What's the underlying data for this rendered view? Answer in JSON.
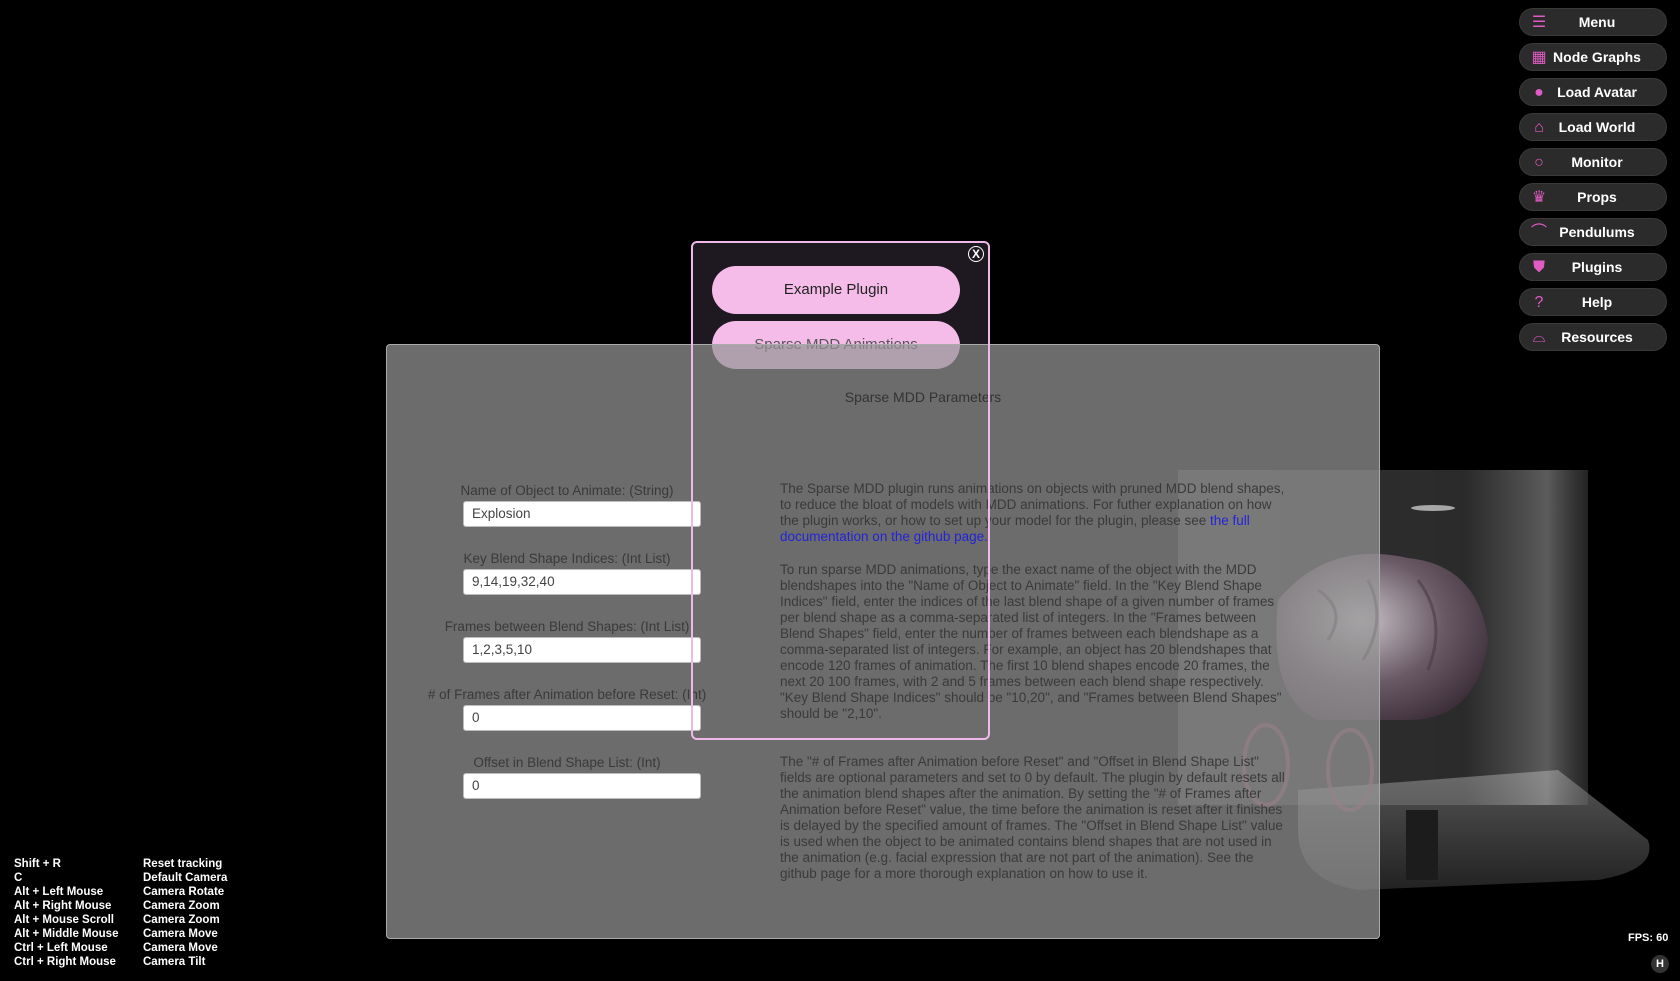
{
  "menu": [
    {
      "label": "Menu",
      "icon": "hamburger-icon"
    },
    {
      "label": "Node Graphs",
      "icon": "grid-icon"
    },
    {
      "label": "Load Avatar",
      "icon": "person-icon"
    },
    {
      "label": "Load World",
      "icon": "house-icon"
    },
    {
      "label": "Monitor",
      "icon": "magnifier-icon"
    },
    {
      "label": "Props",
      "icon": "crown-icon"
    },
    {
      "label": "Pendulums",
      "icon": "pendulum-icon"
    },
    {
      "label": "Plugins",
      "icon": "shield-icon"
    },
    {
      "label": "Help",
      "icon": "question-icon"
    },
    {
      "label": "Resources",
      "icon": "basket-icon"
    }
  ],
  "dialog": {
    "close_label": "X",
    "plugins": [
      "Example Plugin",
      "Sparse MDD Animations"
    ]
  },
  "panel": {
    "title": "Sparse MDD Parameters",
    "fields": [
      {
        "label": "Name of Object to Animate: (String)",
        "value": "Explosion"
      },
      {
        "label": "Key Blend Shape Indices: (Int List)",
        "value": "9,14,19,32,40"
      },
      {
        "label": "Frames between Blend Shapes: (Int List)",
        "value": "1,2,3,5,10"
      },
      {
        "label": "# of Frames after Animation before Reset: (Int)",
        "value": "0"
      },
      {
        "label": "Offset in Blend Shape List: (Int)",
        "value": "0"
      }
    ],
    "desc1_text": "The Sparse MDD plugin runs animations on objects with pruned MDD blend shapes, to reduce the bloat of models with MDD animations. For futher explanation on how the plugin works, or how to set up your model for the plugin, please see ",
    "desc1_link": "the full documentation on the github page.",
    "desc2": "To run sparse MDD animations, type the exact name of the object with the MDD blendshapes into the \"Name of Object to Animate\" field. In the \"Key Blend Shape Indices\" field, enter the indices of the last blend shape of a given number of frames per blend shape as a comma-separated list of integers. In the \"Frames between Blend Shapes\" field, enter the number of frames between each blendshape as a comma-separated list of integers. For example, an object has 20 blendshapes that encode 120 frames of animation. The first 10 blend shapes encode 20 frames, the next 20 100 frames, with 2 and 5 frames between each blend shape respectively. \"Key Blend Shape Indices\" should be \"10,20\", and \"Frames between Blend Shapes\" should be \"2,10\".",
    "desc3": "The \"# of Frames after Animation before Reset\" and \"Offset in Blend Shape List\" fields are optional parameters and set to 0 by default. The plugin by default resets all the animation blend shapes after the animation. By setting the \"# of Frames after Animation before Reset\" value, the time before the animation is reset after it finishes is delayed by the specified amount of frames. The \"Offset in Blend Shape List\" value is used when the object to be animated contains blend shapes that are not used in the animation (e.g. facial expression that are not part of the animation). See the github page for a more thorough explanation on how to use it."
  },
  "shortcuts": [
    {
      "key": "Shift + R",
      "action": "Reset tracking"
    },
    {
      "key": "C",
      "action": "Default Camera"
    },
    {
      "key": "Alt + Left Mouse",
      "action": "Camera Rotate"
    },
    {
      "key": "Alt + Right Mouse",
      "action": "Camera Zoom"
    },
    {
      "key": "Alt + Mouse Scroll",
      "action": "Camera Zoom"
    },
    {
      "key": "Alt + Middle Mouse",
      "action": "Camera Move"
    },
    {
      "key": "Ctrl + Left Mouse",
      "action": "Camera Move"
    },
    {
      "key": "Ctrl + Right Mouse",
      "action": "Camera Tilt"
    }
  ],
  "fps": "FPS: 60",
  "hide_button": "H",
  "colors": {
    "accent": "#e05cc4",
    "plugin_button": "#f5bce9",
    "link": "#2323d8"
  }
}
